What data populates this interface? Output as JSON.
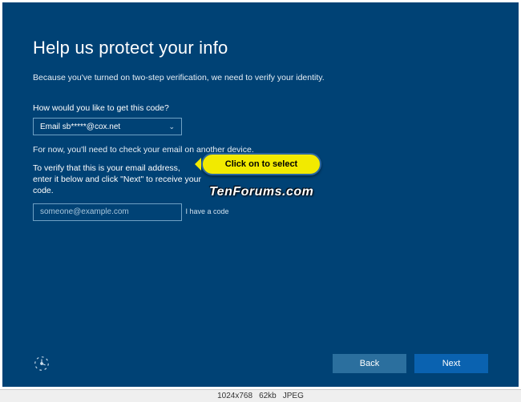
{
  "title": "Help us protect your info",
  "subtitle": "Because you've turned on two-step verification, we need to verify your identity.",
  "question": "How would you like to get this code?",
  "select": {
    "value": "Email sb*****@cox.net"
  },
  "note": "For now, you'll need to check your email on another device.",
  "verify_label": "To verify that this is your email address, enter it below and click \"Next\" to receive your code.",
  "email": {
    "placeholder": "someone@example.com",
    "value": ""
  },
  "have_code": "I have a code",
  "callout": "Click on to select",
  "watermark": "TenForums.com",
  "buttons": {
    "back": "Back",
    "next": "Next"
  },
  "infobar": {
    "dimensions": "1024x768",
    "size": "62kb",
    "format": "JPEG"
  }
}
